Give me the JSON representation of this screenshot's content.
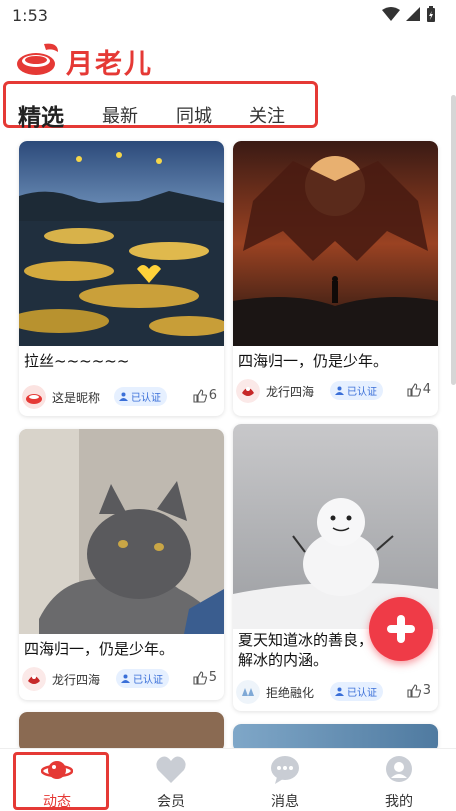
{
  "status_bar": {
    "time": "1:53"
  },
  "header": {
    "app_name": "月老儿"
  },
  "tabs": [
    {
      "label": "精选",
      "active": true
    },
    {
      "label": "最新",
      "active": false
    },
    {
      "label": "同城",
      "active": false
    },
    {
      "label": "关注",
      "active": false
    }
  ],
  "feed": [
    {
      "title": "拉丝~~~~~~",
      "author": "这是昵称",
      "badge": "已认证",
      "likes": "6",
      "image": "lake-with-flowers-photo"
    },
    {
      "title": "四海归一，仍是少年。",
      "author": "龙行四海",
      "badge": "已认证",
      "likes": "4",
      "image": "dragon-silhouette-photo"
    },
    {
      "title": "四海归一，仍是少年。",
      "author": "龙行四海",
      "badge": "已认证",
      "likes": "5",
      "image": "grey-cat-photo"
    },
    {
      "title": "夏天知道冰的善良，冬天理解冰的内涵。",
      "author": "拒绝融化",
      "badge": "已认证",
      "likes": "3",
      "image": "snowman-photo"
    }
  ],
  "fab": {
    "icon": "plus-icon"
  },
  "bottom_nav": [
    {
      "label": "动态",
      "icon": "planet-icon",
      "active": true
    },
    {
      "label": "会员",
      "icon": "heart-icon",
      "active": false
    },
    {
      "label": "消息",
      "icon": "chat-bubble-icon",
      "active": false
    },
    {
      "label": "我的",
      "icon": "profile-icon",
      "active": false
    }
  ],
  "colors": {
    "brand": "#e53935",
    "fab": "#ef3b47",
    "badge_bg": "#e6f0ff",
    "badge_text": "#3a6fd8"
  }
}
